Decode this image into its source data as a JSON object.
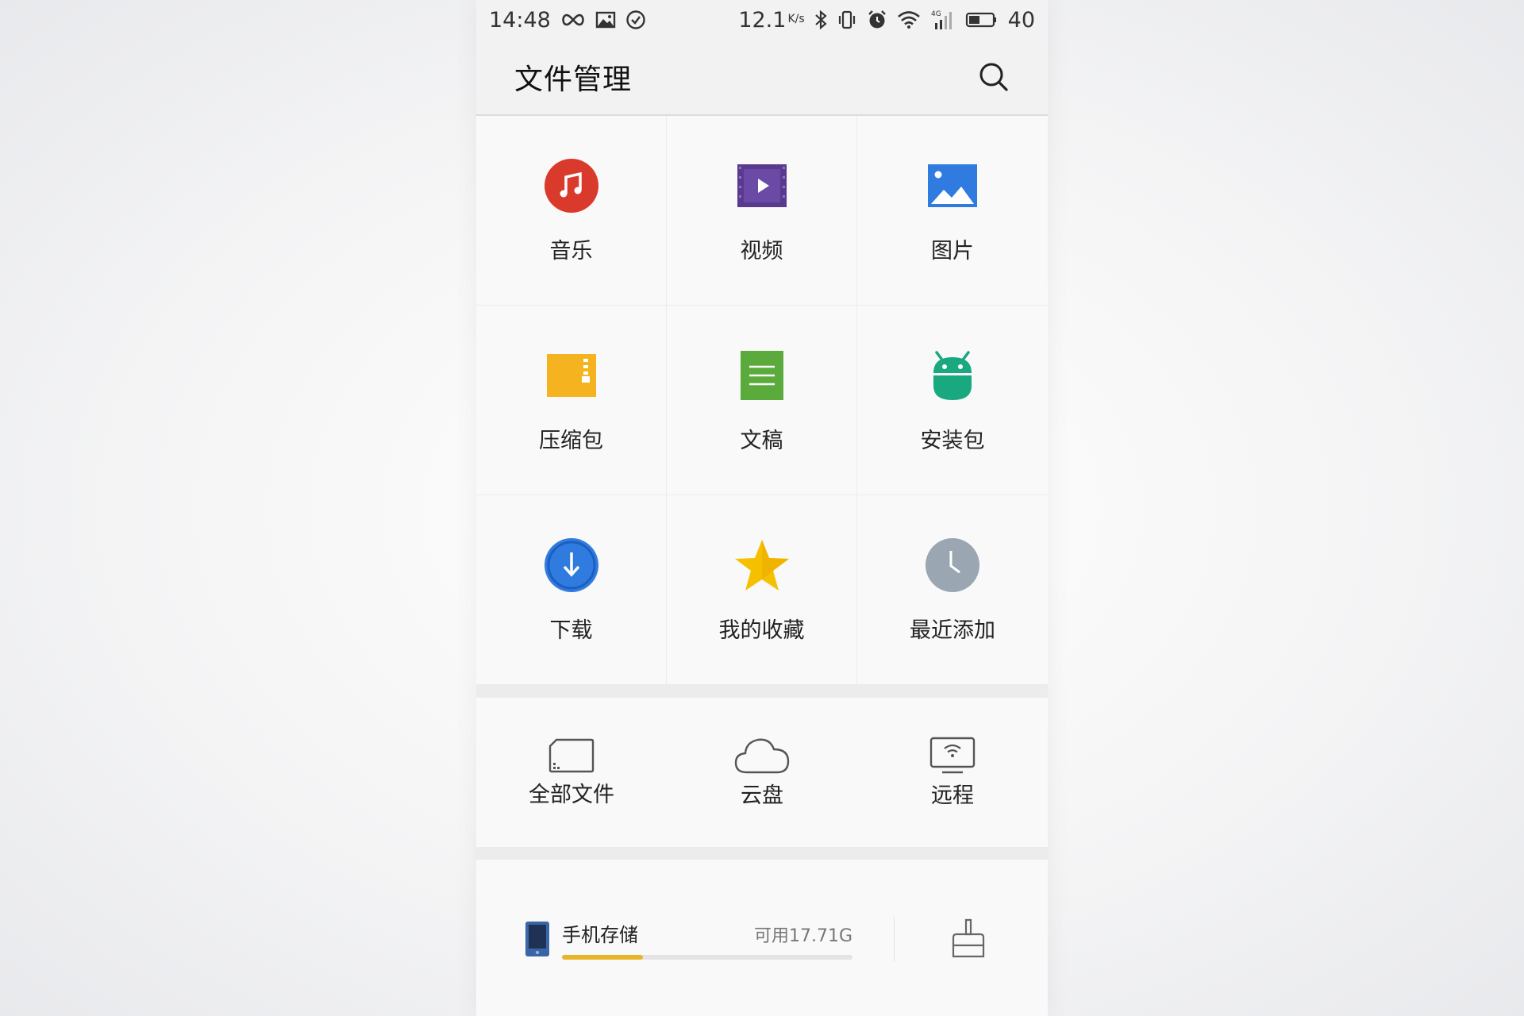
{
  "status_bar": {
    "time": "14:48",
    "speed": "12.1",
    "speed_unit": "K/s",
    "battery": "40",
    "network": "4G",
    "icons": [
      "infinity-icon",
      "image-icon",
      "check-circle-icon",
      "bluetooth-icon",
      "vibrate-icon",
      "alarm-icon",
      "wifi-icon",
      "signal-icon",
      "battery-icon"
    ]
  },
  "header": {
    "title": "文件管理",
    "search_icon": "search-icon"
  },
  "categories": [
    {
      "label": "音乐",
      "icon": "music-icon",
      "color": "#d93a2b"
    },
    {
      "label": "视频",
      "icon": "video-icon",
      "color": "#5a3a8f"
    },
    {
      "label": "图片",
      "icon": "picture-icon",
      "color": "#2f7be0"
    },
    {
      "label": "压缩包",
      "icon": "archive-icon",
      "color": "#f5b320"
    },
    {
      "label": "文稿",
      "icon": "document-icon",
      "color": "#5aab3c"
    },
    {
      "label": "安装包",
      "icon": "android-icon",
      "color": "#1aa881"
    },
    {
      "label": "下载",
      "icon": "download-icon",
      "color": "#2f7be0"
    },
    {
      "label": "我的收藏",
      "icon": "star-icon",
      "color": "#f5c000"
    },
    {
      "label": "最近添加",
      "icon": "clock-icon",
      "color": "#9aa7b3"
    }
  ],
  "entries": [
    {
      "label": "全部文件",
      "icon": "sd-card-icon"
    },
    {
      "label": "云盘",
      "icon": "cloud-icon"
    },
    {
      "label": "远程",
      "icon": "remote-screen-icon"
    }
  ],
  "storage": {
    "name": "手机存储",
    "free": "可用17.71G",
    "used_fraction": 0.28,
    "bar_color": "#e8b42a",
    "icon": "phone-storage-icon",
    "clean_icon": "broom-icon"
  }
}
